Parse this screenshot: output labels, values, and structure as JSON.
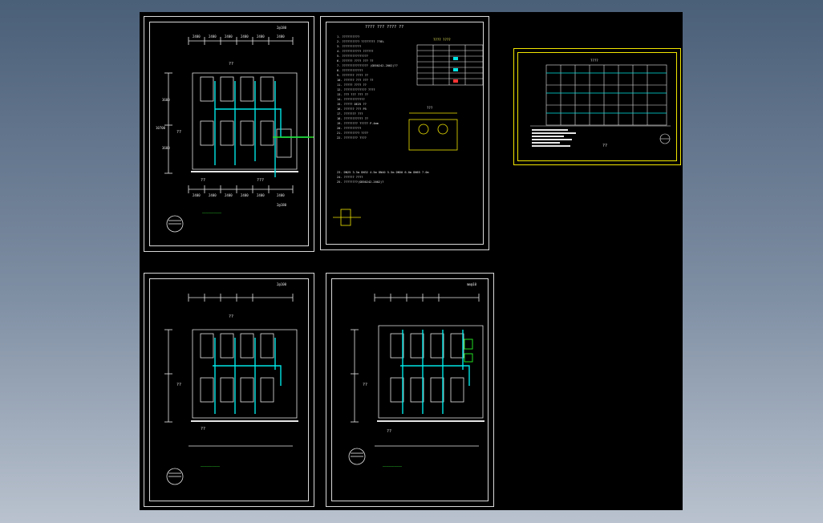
{
  "viewport": {
    "background": "#000000"
  },
  "colors": {
    "line": "#e6e6e6",
    "pipe": "#00e5e5",
    "green": "#22dd22",
    "yellow": "#f2e600",
    "red": "#ff3333"
  },
  "sheet_tl": {
    "top_dims": [
      "2400",
      "2400",
      "2400",
      "2400",
      "2400",
      "2400"
    ],
    "bottom_dims": [
      "2400",
      "2400",
      "2400",
      "2400",
      "2400",
      "2400"
    ],
    "left_dims": [
      "3600",
      "3600"
    ],
    "left_total": "10700",
    "corner_label": "2@180",
    "caption": "——————————",
    "north_icon": "north-arrow-icon"
  },
  "sheet_notes": {
    "title": "???? ??? ???? ??",
    "table_title": "???? ????",
    "notes": [
      "1. ??????????",
      "2. ?????????? ???????? ??8%",
      "3. ???????????",
      "4. ??????????? ??????",
      "5. ???????????????",
      "6. ?????? ???? ??? ??",
      "7. ??????????????? (GB50242-2002)??",
      "8. ????????????",
      "9. ??????? ???? ??",
      "10. ?????? ??? ??? ??",
      "11. ????? ???? ??",
      "12. ????????????? ????",
      "13. ??? ??? ??? ??",
      "14. ????????????",
      "15. ????? DE25 ??",
      "16. ?????? ??? P5",
      "17. ??????? ???",
      "18. ??????????? ??",
      "19. ???????? ????? P.4mm",
      "20. ??????????",
      "21. ????????? ????",
      "22. ???????? ????",
      "23. DN25 3.5m DN32 4.5m DN40 5.5m DN50 6.0m DN65 7.0m",
      "24. ?????? ????",
      "25. ????????(GB50242-2002)?"
    ],
    "detail_label": "???"
  },
  "sheet_bl": {
    "corner_label": "2@100",
    "caption": "——————————"
  },
  "sheet_bm": {
    "corner_label": "mm@10",
    "caption": "——————————"
  },
  "sheet_right": {
    "label": "??",
    "header_label": "????"
  }
}
